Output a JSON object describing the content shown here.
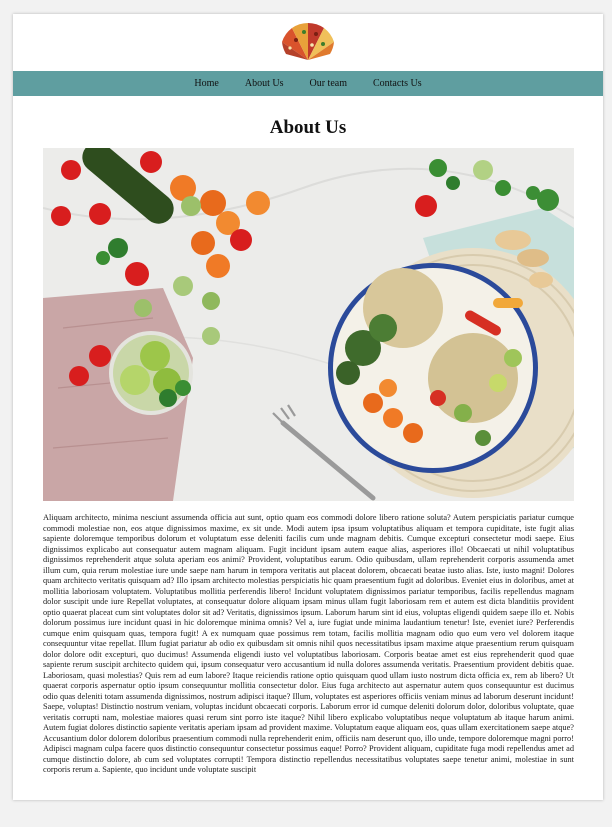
{
  "nav": {
    "items": [
      "Home",
      "About Us",
      "Our team",
      "Contacts Us"
    ]
  },
  "main": {
    "title": "About Us",
    "hero_image": "vegetable-bowl-photo",
    "paragraph": "Aliquam architecto, minima nesciunt assumenda officia aut sunt, optio quam eos commodi dolore libero ratione soluta? Autem perspiciatis pariatur cumque commodi molestiae non, eos atque dignissimos maxime, ex sit unde. Modi autem ipsa ipsum voluptatibus aliquam et tempora cupiditate, iste fugit alias sapiente doloremque temporibus dolorum et voluptatum esse deleniti facilis cum unde magnam debitis. Cumque excepturi consectetur modi saepe. Eius dignissimos explicabo aut consequatur autem magnam aliquam. Fugit incidunt ipsam autem eaque alias, asperiores illo! Obcaecati ut nihil voluptatibus dignissimos reprehenderit atque soluta aperiam eos animi? Provident, voluptatibus earum. Odio quibusdam, ullam reprehenderit corporis assumenda amet illum cum, quia rerum molestiae iure unde saepe nam harum in tempora veritatis aut placeat dolorem, obcaecati beatae iusto alias. Iste, iusto magni! Dolores quam architecto veritatis quisquam ad? Illo ipsam architecto molestias perspiciatis hic quam praesentium fugit ad doloribus. Eveniet eius in doloribus, amet at mollitia laboriosam voluptatem. Voluptatibus mollitia perferendis libero! Incidunt voluptatem dignissimos pariatur temporibus, facilis repellendus magnam dolor suscipit unde iure Repellat voluptates, at consequatur dolore aliquam ipsam minus ullam fugit laboriosam rem et autem est dicta blanditiis provident optio quaerat placeat cum sint voluptates dolor sit ad? Veritatis, dignissimos ipsum. Laborum harum sint id eius, voluptas eligendi quidem saepe illo et. Nobis dolorum possimus iure incidunt quasi in hic doloremque minima omnis? Vel a, iure fugiat unde minima laudantium tenetur! Iste, eveniet iure? Perferendis cumque enim quisquam quas, tempora fugit! A ex numquam quae possimus rem totam, facilis mollitia magnam odio quo eum vero vel dolorem itaque consequuntur vitae repellat. Illum fugiat pariatur ab odio ex quibusdam sit omnis nihil quos necessitatibus ipsam maxime atque praesentium rerum quisquam dolor dolore odit excepturi, quo ducimus! Assumenda eligendi iusto vel voluptatibus laboriosam. Corporis beatae amet est eius reprehenderit quod quae sapiente rerum suscipit architecto quidem qui, ipsum consequatur vero accusantium id nulla dolores assumenda veritatis. Praesentium provident debitis quae. Laboriosam, quasi molestias? Quis rem ad eum labore? Itaque reiciendis ratione optio quisquam quod ullam iusto nostrum dicta officia ex, rem ab libero? Ut quaerat corporis aspernatur optio ipsum consequuntur mollitia consectetur dolor. Eius fuga architecto aut aspernatur autem quos consequuntur est ducimus odio quas deleniti totam assumenda dignissimos, nostrum adipisci itaque? Illum, voluptates est asperiores officiis veniam minus ad laborum deserunt incidunt! Saepe, voluptas! Distinctio nostrum veniam, voluptas incidunt obcaecati corporis. Laborum error id cumque deleniti dolorum dolor, doloribus voluptate, quae veritatis corrupti nam, molestiae maiores quasi rerum sint porro iste itaque? Nihil libero explicabo voluptatibus neque voluptatum ab itaque harum animi. Autem fugiat dolores distinctio sapiente veritatis aperiam ipsam ad provident maxime. Voluptatum eaque aliquam eos, quas ullam exercitationem saepe atque? Accusantium dolor dolorem doloribus praesentium commodi nulla reprehenderit enim, officiis nam deserunt quo, illo unde, tempore doloremque magni porro! Adipisci magnam culpa facere quos distinctio consequuntur consectetur possimus eaque! Porro? Provident aliquam, cupiditate fuga modi repellendus amet ad cumque distinctio dolore, ab cum sed voluptates corrupti! Tempora distinctio repellendus necessitatibus voluptates saepe tenetur animi, molestiae in sunt corporis rerum a. Sapiente, quo incidunt unde voluptate suscipit"
  },
  "colors": {
    "navbar": "#5f9ea0",
    "page_bg": "#f2f2f2",
    "card_bg": "#ffffff"
  },
  "icons": {
    "logo": "pizza-slices-logo"
  }
}
